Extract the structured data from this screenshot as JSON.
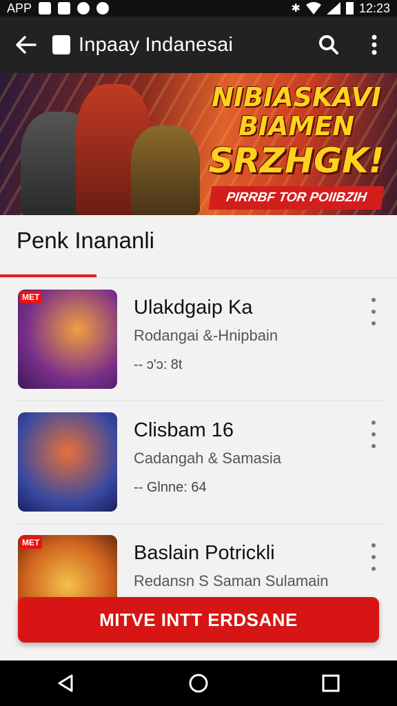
{
  "statusbar": {
    "left_text": "APP",
    "time": "12:23"
  },
  "appbar": {
    "title": "Inpaay Indanesai"
  },
  "banner": {
    "line1": "NIBIASKAVI",
    "line2": "BIAMEN",
    "line3": "SRZHGK!",
    "ribbon": "PIRRBF TOR POIIBZIH"
  },
  "section": {
    "title": "Penk Inananli"
  },
  "items": [
    {
      "badge": "MET",
      "name": "Ulakdgaip Ka",
      "subtitle": "Rodangai &-Hnipbain",
      "meta": "-- ɔ'ɔ: 8t"
    },
    {
      "badge": "",
      "name": "Clisbam 16",
      "subtitle": "Cadangah & Samasia",
      "meta": "-- Glnne: 64"
    },
    {
      "badge": "MET",
      "name": "Baslain Potrickli",
      "subtitle": "Redansn S Saman Sulamain",
      "meta": ""
    }
  ],
  "cta": {
    "label": "MITVE INTT ERDSANE"
  },
  "colors": {
    "accent": "#d81515",
    "appbar": "#222222",
    "banner_text": "#ffd21f"
  }
}
